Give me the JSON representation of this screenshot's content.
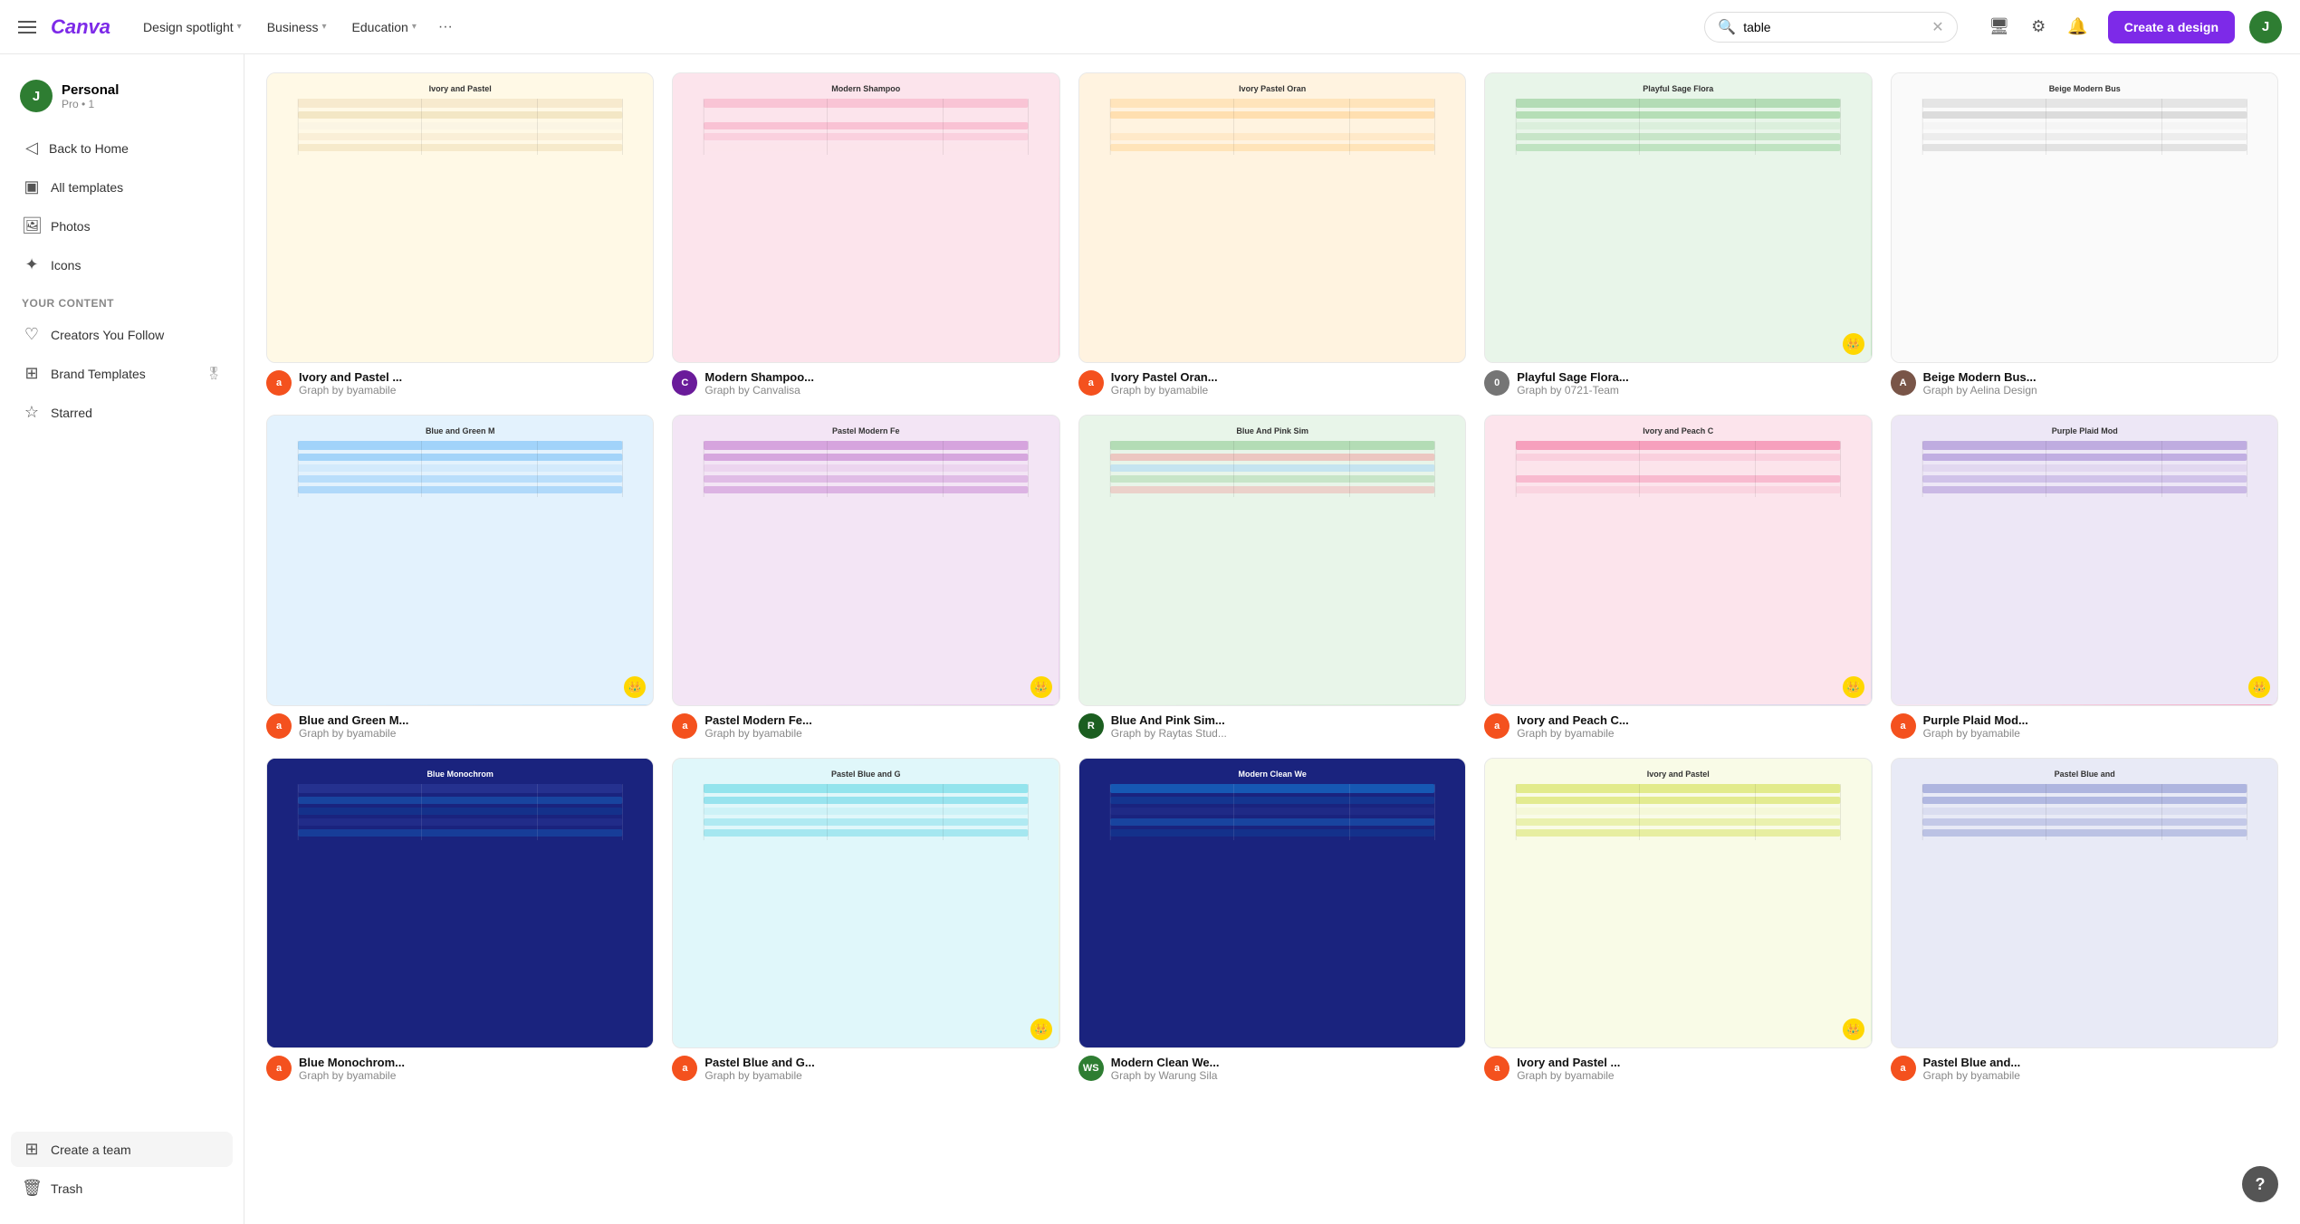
{
  "topnav": {
    "logo": "Canva",
    "menus": [
      {
        "label": "Design spotlight",
        "id": "design-spotlight"
      },
      {
        "label": "Business",
        "id": "business"
      },
      {
        "label": "Education",
        "id": "education"
      }
    ],
    "search_placeholder": "table",
    "search_value": "table",
    "create_label": "Create a design",
    "user_initial": "J"
  },
  "sidebar": {
    "profile_name": "Personal",
    "profile_sub": "Pro • 1",
    "profile_initial": "J",
    "nav_items": [
      {
        "label": "Back to Home",
        "icon": "◁",
        "id": "back-to-home"
      },
      {
        "label": "All templates",
        "icon": "▣",
        "id": "all-templates"
      },
      {
        "label": "Photos",
        "icon": "🖼",
        "id": "photos"
      },
      {
        "label": "Icons",
        "icon": "✦",
        "id": "icons"
      }
    ],
    "your_content_label": "Your Content",
    "content_items": [
      {
        "label": "Creators You Follow",
        "icon": "♡",
        "id": "creators-follow"
      },
      {
        "label": "Brand Templates",
        "icon": "⊞",
        "id": "brand-templates",
        "has_badge": true
      },
      {
        "label": "Starred",
        "icon": "☆",
        "id": "starred"
      }
    ],
    "bottom_items": [
      {
        "label": "Create a team",
        "icon": "⊞",
        "id": "create-team"
      },
      {
        "label": "Trash",
        "icon": "🗑",
        "id": "trash"
      }
    ]
  },
  "templates": [
    {
      "id": "t1",
      "title": "Ivory and Pastel ...",
      "type": "Graph",
      "author": "byamabile",
      "color_bg": "#fff9e6",
      "avatar_color": "#f4511e",
      "avatar_initial": "a",
      "thumb_class": "t1",
      "has_crown": false
    },
    {
      "id": "t2",
      "title": "Modern Shampoo...",
      "type": "Graph",
      "author": "Canvalisa",
      "color_bg": "#fce4ec",
      "avatar_color": "#6a1b9a",
      "avatar_initial": "C",
      "thumb_class": "t2",
      "has_crown": false
    },
    {
      "id": "t3",
      "title": "Ivory Pastel Oran...",
      "type": "Graph",
      "author": "byamabile",
      "color_bg": "#fff3e0",
      "avatar_color": "#f4511e",
      "avatar_initial": "a",
      "thumb_class": "t3",
      "has_crown": false
    },
    {
      "id": "t4",
      "title": "Playful Sage Flora...",
      "type": "Graph",
      "author": "0721-Team",
      "color_bg": "#e8f5e9",
      "avatar_color": "#757575",
      "avatar_initial": "0",
      "thumb_class": "t4",
      "has_crown": true
    },
    {
      "id": "t5",
      "title": "Beige Modern Bus...",
      "type": "Graph",
      "author": "Aelina Design",
      "color_bg": "#fafafa",
      "avatar_color": "#795548",
      "avatar_initial": "A",
      "thumb_class": "t5",
      "has_crown": false
    },
    {
      "id": "t6",
      "title": "Blue and Green M...",
      "type": "Graph",
      "author": "byamabile",
      "color_bg": "#e3f2fd",
      "avatar_color": "#f4511e",
      "avatar_initial": "a",
      "thumb_class": "t6",
      "has_crown": true
    },
    {
      "id": "t7",
      "title": "Pastel Modern Fe...",
      "type": "Graph",
      "author": "byamabile",
      "color_bg": "#f3e5f5",
      "avatar_color": "#f4511e",
      "avatar_initial": "a",
      "thumb_class": "t7",
      "has_crown": true
    },
    {
      "id": "t8",
      "title": "Blue And Pink Sim...",
      "type": "Graph",
      "author": "Raytas Stud...",
      "color_bg": "#e8f5e9",
      "avatar_color": "#1b5e20",
      "avatar_initial": "R",
      "thumb_class": "t8",
      "has_crown": false
    },
    {
      "id": "t9",
      "title": "Ivory and Peach C...",
      "type": "Graph",
      "author": "byamabile",
      "color_bg": "#fce4ec",
      "avatar_color": "#f4511e",
      "avatar_initial": "a",
      "thumb_class": "t9",
      "has_crown": true
    },
    {
      "id": "t10",
      "title": "Purple Plaid Mod...",
      "type": "Graph",
      "author": "byamabile",
      "color_bg": "#ede7f6",
      "avatar_color": "#f4511e",
      "avatar_initial": "a",
      "thumb_class": "t10",
      "has_crown": true
    },
    {
      "id": "t11",
      "title": "Blue Monochrom...",
      "type": "Graph",
      "author": "byamabile",
      "color_bg": "#1a237e",
      "avatar_color": "#f4511e",
      "avatar_initial": "a",
      "thumb_class": "t11",
      "has_crown": false
    },
    {
      "id": "t12",
      "title": "Pastel Blue and G...",
      "type": "Graph",
      "author": "byamabile",
      "color_bg": "#e0f7fa",
      "avatar_color": "#f4511e",
      "avatar_initial": "a",
      "thumb_class": "t12",
      "has_crown": true
    },
    {
      "id": "t13",
      "title": "Modern Clean We...",
      "type": "Graph",
      "author": "Warung Sila",
      "color_bg": "#1a237e",
      "avatar_color": "#2e7d32",
      "avatar_initial": "WS",
      "thumb_class": "t13",
      "has_crown": false
    },
    {
      "id": "t14",
      "title": "Ivory and Pastel ...",
      "type": "Graph",
      "author": "byamabile",
      "color_bg": "#f9fbe7",
      "avatar_color": "#f4511e",
      "avatar_initial": "a",
      "thumb_class": "t14",
      "has_crown": true
    },
    {
      "id": "t15",
      "title": "Pastel Blue and...",
      "type": "Graph",
      "author": "byamabile",
      "color_bg": "#e8eaf6",
      "avatar_color": "#f4511e",
      "avatar_initial": "a",
      "thumb_class": "t15",
      "has_crown": false
    }
  ],
  "help": {
    "label": "?"
  }
}
